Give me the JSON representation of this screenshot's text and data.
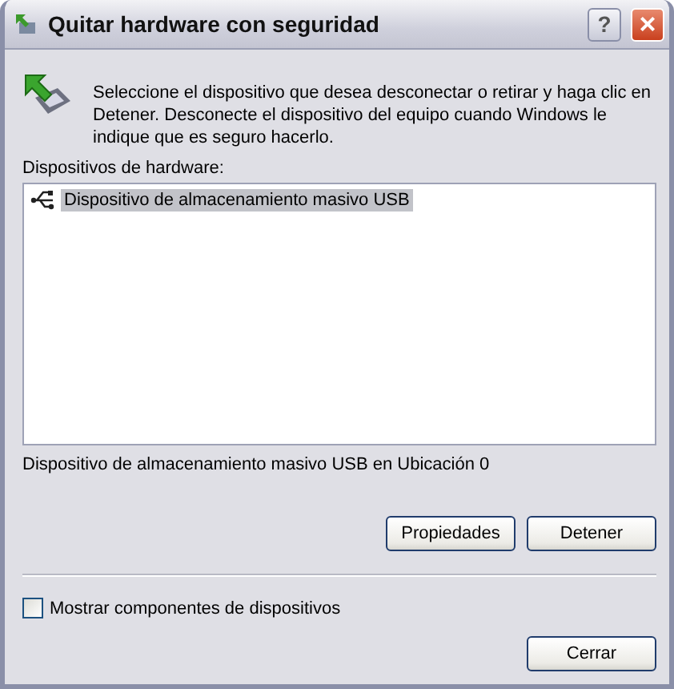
{
  "window": {
    "title": "Quitar hardware con seguridad"
  },
  "title_buttons": [
    {
      "kind": "help",
      "label": "?"
    },
    {
      "kind": "close",
      "label": "×"
    }
  ],
  "instructions": "Seleccione el dispositivo que desea desconectar o retirar y haga clic en Detener. Desconecte el dispositivo del equipo cuando Windows le indique que es seguro hacerlo.",
  "devices": {
    "label": "Dispositivos de hardware:",
    "items": [
      {
        "label": "Dispositivo de almacenamiento masivo USB",
        "selected": true
      }
    ]
  },
  "status": "Dispositivo de almacenamiento masivo USB en Ubicación 0",
  "device_buttons": [
    "Propiedades",
    "Detener"
  ],
  "show_components": {
    "label": "Mostrar componentes de dispositivos",
    "checked": false
  },
  "close_button": "Cerrar"
}
